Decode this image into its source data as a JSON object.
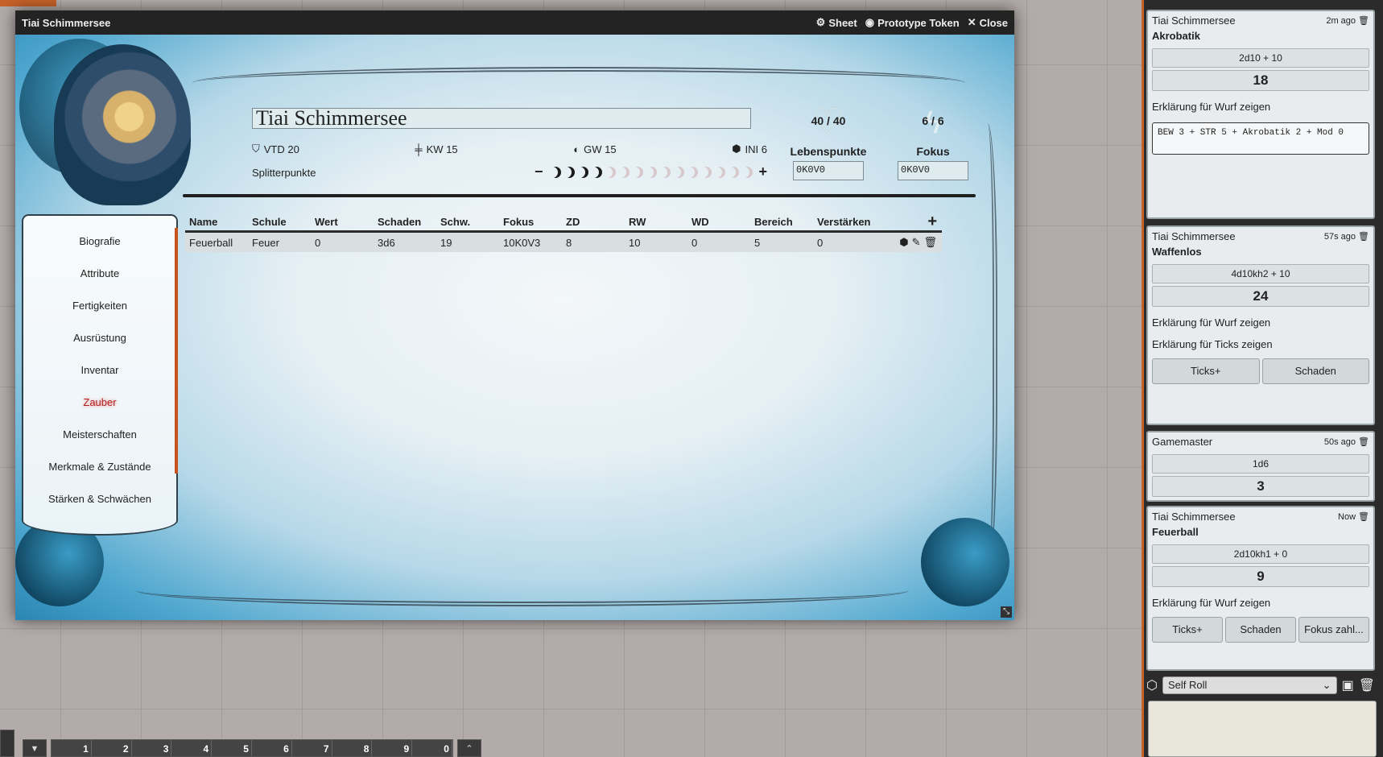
{
  "window": {
    "title": "Tiai Schimmersee",
    "controls": [
      {
        "icon": "gear-icon",
        "label": "Sheet"
      },
      {
        "icon": "user-circle-icon",
        "label": "Prototype Token"
      },
      {
        "icon": "close-icon",
        "label": "Close"
      }
    ]
  },
  "character": {
    "name": "Tiai Schimmersee",
    "stats": {
      "vtd": "VTD 20",
      "kw": "KW 15",
      "gw": "GW 15",
      "ini": "INI 6"
    },
    "splitter_label": "Splitterpunkte",
    "splitter_full": 4,
    "splitter_total": 15,
    "hp": {
      "value": "40 / 40",
      "label": "Lebenspunkte",
      "input": "0K0V0"
    },
    "focus": {
      "value": "6 / 6",
      "label": "Fokus",
      "input": "0K0V0"
    }
  },
  "sidebar": {
    "items": [
      {
        "label": "Biografie"
      },
      {
        "label": "Attribute"
      },
      {
        "label": "Fertigkeiten"
      },
      {
        "label": "Ausrüstung"
      },
      {
        "label": "Inventar"
      },
      {
        "label": "Zauber",
        "active": true
      },
      {
        "label": "Meisterschaften"
      },
      {
        "label": "Merkmale & Zustände"
      },
      {
        "label": "Stärken & Schwächen"
      }
    ]
  },
  "spells_table": {
    "headers": [
      "Name",
      "Schule",
      "Wert",
      "Schaden",
      "Schw.",
      "Fokus",
      "ZD",
      "RW",
      "WD",
      "Bereich",
      "Verstärken"
    ],
    "rows": [
      [
        "Feuerball",
        "Feuer",
        "0",
        "3d6",
        "19",
        "10K0V3",
        "8",
        "10",
        "0",
        "5",
        "0"
      ]
    ]
  },
  "hotbar": {
    "slots": [
      "1",
      "2",
      "3",
      "4",
      "5",
      "6",
      "7",
      "8",
      "9",
      "0"
    ]
  },
  "chat": {
    "messages": [
      {
        "speaker": "Tiai Schimmersee",
        "time": "2m ago",
        "flavor": "Akrobatik",
        "formula": "2d10 + 10",
        "total": "18",
        "explain": "Erklärung für Wurf zeigen",
        "details": "BEW 3 + STR 5 + Akrobatik 2 + Mod 0"
      },
      {
        "speaker": "Tiai Schimmersee",
        "time": "57s ago",
        "flavor": "Waffenlos",
        "formula": "4d10kh2 + 10",
        "total": "24",
        "explain": "Erklärung für Wurf zeigen",
        "explain2": "Erklärung für Ticks zeigen",
        "buttons": [
          "Ticks+",
          "Schaden"
        ]
      },
      {
        "speaker": "Gamemaster",
        "time": "50s ago",
        "formula": "1d6",
        "total": "3"
      },
      {
        "speaker": "Tiai Schimmersee",
        "time": "Now",
        "flavor": "Feuerball",
        "formula": "2d10kh1 + 0",
        "total": "9",
        "explain": "Erklärung für Wurf zeigen",
        "buttons": [
          "Ticks+",
          "Schaden",
          "Fokus zahl..."
        ]
      }
    ],
    "roll_mode": "Self Roll"
  },
  "colors": {
    "accent": "#c7622a",
    "active_nav": "#b02020"
  }
}
